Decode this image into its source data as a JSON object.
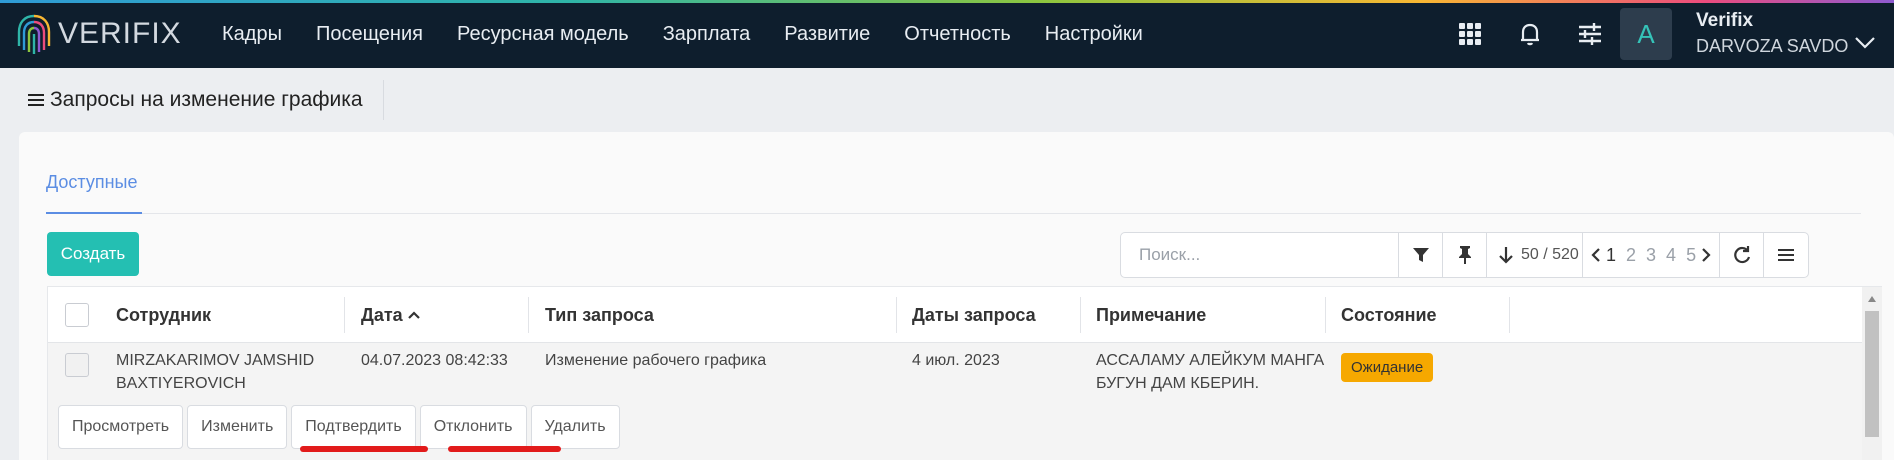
{
  "nav": {
    "brand": "VERIFIX",
    "items": [
      "Кадры",
      "Посещения",
      "Ресурсная модель",
      "Зарплата",
      "Развитие",
      "Отчетность",
      "Настройки"
    ],
    "icons": [
      "apps-grid-icon",
      "bell-icon",
      "sliders-icon"
    ]
  },
  "user": {
    "avatar_letter": "A",
    "name": "Verifix",
    "organization": "DARVOZA SAVDO"
  },
  "page": {
    "title": "Запросы на изменение графика"
  },
  "tabs": [
    {
      "label": "Доступные",
      "active": true
    }
  ],
  "toolbar": {
    "create_label": "Создать",
    "search_placeholder": "Поиск...",
    "rows_count": "50 / 520",
    "pages": [
      "1",
      "2",
      "3",
      "4",
      "5"
    ],
    "current_page": "1"
  },
  "table": {
    "columns": [
      "Сотрудник",
      "Дата",
      "Тип запроса",
      "Даты запроса",
      "Примечание",
      "Состояние"
    ],
    "sort_column": "Дата",
    "rows": [
      {
        "employee_line1": "MIRZAKARIMOV JAMSHID",
        "employee_line2": "BAXTIYEROVICH",
        "date": "04.07.2023 08:42:33",
        "request_type": "Изменение рабочего графика",
        "request_dates": "4 июл. 2023",
        "note_line1": "АССАЛАМУ АЛЕЙКУМ МАНГА",
        "note_line2": "БУГУН ДАМ КБЕРИН.",
        "status": "Ожидание"
      }
    ],
    "row_actions": [
      "Просмотреть",
      "Изменить",
      "Подтвердить",
      "Отклонить",
      "Удалить"
    ]
  },
  "colors": {
    "topbar": "#0e1e2d",
    "accent": "#24bfb2",
    "tab_active": "#5b8de3",
    "status_pending": "#f6a800",
    "annotation": "#e21b1b"
  }
}
